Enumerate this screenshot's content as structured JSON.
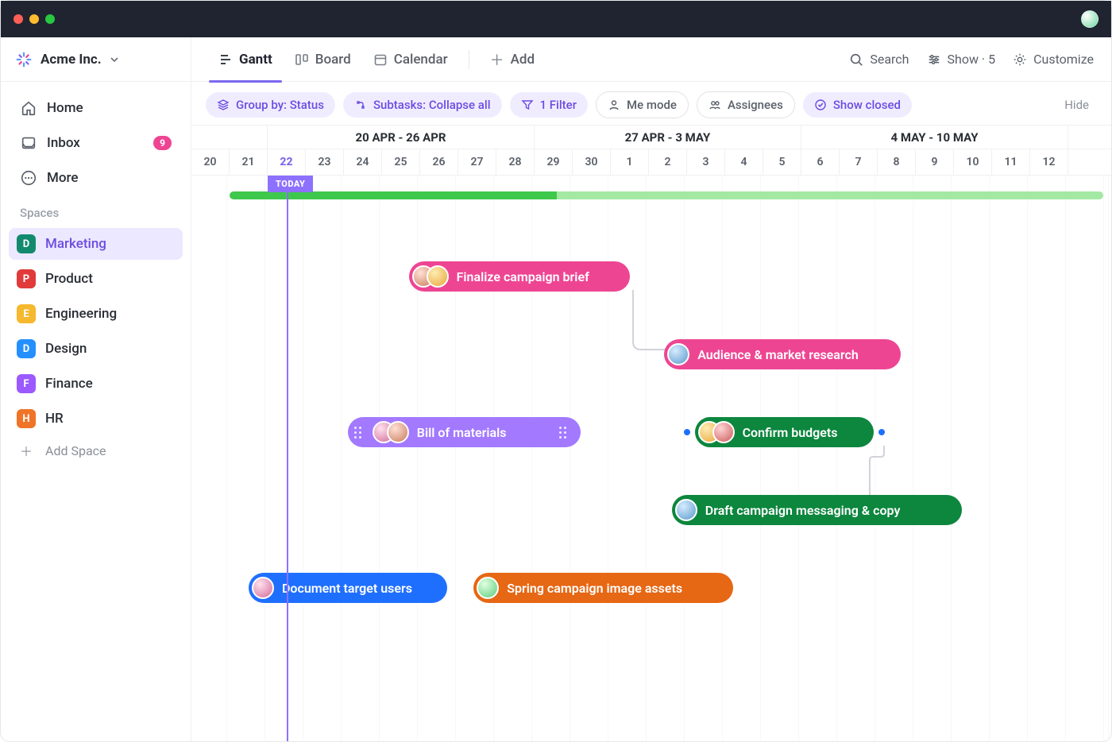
{
  "workspace": {
    "name": "Acme Inc."
  },
  "nav": {
    "home": "Home",
    "inbox": "Inbox",
    "inbox_badge": "9",
    "more": "More"
  },
  "sidebar": {
    "section_label": "Spaces",
    "spaces": [
      {
        "letter": "D",
        "label": "Marketing",
        "color": "#138a6e",
        "active": true
      },
      {
        "letter": "P",
        "label": "Product",
        "color": "#e03a3a",
        "active": false
      },
      {
        "letter": "E",
        "label": "Engineering",
        "color": "#f5b82e",
        "active": false
      },
      {
        "letter": "D",
        "label": "Design",
        "color": "#2490ff",
        "active": false
      },
      {
        "letter": "F",
        "label": "Finance",
        "color": "#9b59ff",
        "active": false
      },
      {
        "letter": "H",
        "label": "HR",
        "color": "#f07427",
        "active": false
      }
    ],
    "add_space": "Add Space"
  },
  "views": {
    "gantt": "Gantt",
    "board": "Board",
    "calendar": "Calendar",
    "add": "Add"
  },
  "topbar": {
    "search": "Search",
    "show": "Show · 5",
    "customize": "Customize"
  },
  "filters": {
    "group_by": "Group by: Status",
    "subtasks": "Subtasks: Collapse all",
    "filter": "1 Filter",
    "me_mode": "Me mode",
    "assignees": "Assignees",
    "show_closed": "Show closed",
    "hide": "Hide"
  },
  "timeline": {
    "today_label": "TODAY",
    "ranges": [
      {
        "label": "20 APR - 26 APR",
        "span_days": 7,
        "start_index": 2
      },
      {
        "label": "27 APR - 3 MAY",
        "span_days": 7,
        "start_index": 9
      },
      {
        "label": "4 MAY - 10 MAY",
        "span_days": 7,
        "start_index": 16
      }
    ],
    "days": [
      "20",
      "21",
      "22",
      "23",
      "24",
      "25",
      "26",
      "27",
      "28",
      "29",
      "30",
      "1",
      "2",
      "3",
      "4",
      "5",
      "6",
      "7",
      "8",
      "9",
      "10",
      "11",
      "12"
    ],
    "today_index": 2
  },
  "tasks": [
    {
      "label": "Finalize campaign brief",
      "color": "pink",
      "left_day": 5.7,
      "width_days": 5.8,
      "row": 0,
      "avatars": [
        "av1",
        "av2"
      ]
    },
    {
      "label": "Audience & market research",
      "color": "pink",
      "left_day": 12.4,
      "width_days": 6.2,
      "row": 1,
      "avatars": [
        "av3"
      ]
    },
    {
      "label": "Bill of materials",
      "color": "purple",
      "left_day": 4.1,
      "width_days": 6.1,
      "row": 2,
      "avatars": [
        "av4",
        "av1"
      ],
      "handles": true
    },
    {
      "label": "Confirm budgets",
      "color": "green",
      "left_day": 13.2,
      "width_days": 4.7,
      "row": 2,
      "avatars": [
        "av2",
        "av7"
      ],
      "dots": true
    },
    {
      "label": "Draft campaign messaging & copy",
      "color": "green",
      "left_day": 12.6,
      "width_days": 7.6,
      "row": 3,
      "avatars": [
        "av3"
      ]
    },
    {
      "label": "Document target users",
      "color": "blue",
      "left_day": 1.5,
      "width_days": 5.2,
      "row": 4,
      "avatars": [
        "av4"
      ]
    },
    {
      "label": "Spring campaign image assets",
      "color": "orange",
      "left_day": 7.4,
      "width_days": 6.8,
      "row": 4,
      "avatars": [
        "av6"
      ]
    }
  ]
}
